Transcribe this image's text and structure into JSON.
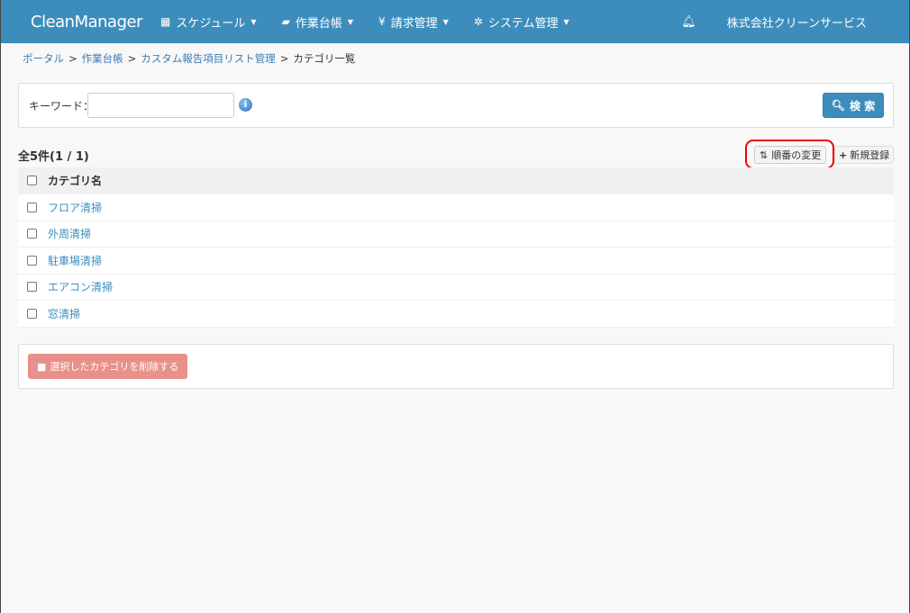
{
  "nav": {
    "brand": "CleanManager",
    "menus": [
      {
        "icon": "calendar-icon",
        "glyph": "▦",
        "label": "スケジュール"
      },
      {
        "icon": "book-icon",
        "glyph": "▰",
        "label": "作業台帳"
      },
      {
        "icon": "yen-icon",
        "glyph": "¥",
        "label": "請求管理"
      },
      {
        "icon": "gears-icon",
        "glyph": "✲",
        "label": "システム管理"
      }
    ],
    "bell": "🔔",
    "company": "株式会社クリーンサービス"
  },
  "breadcrumb": {
    "items": [
      "ポータル",
      "作業台帳",
      "カスタム報告項目リスト管理"
    ],
    "current": "カテゴリ一覧",
    "sep": ">"
  },
  "search": {
    "label": "キーワード：",
    "value": "",
    "button": "検 索"
  },
  "list": {
    "count": "全5件(1 / 1)",
    "order_button": "順番の変更",
    "new_button": "新規登録",
    "header": "カテゴリ名",
    "rows": [
      "フロア清掃",
      "外周清掃",
      "駐車場清掃",
      "エアコン清掃",
      "窓清掃"
    ]
  },
  "delete_button": "選択したカテゴリを削除する"
}
